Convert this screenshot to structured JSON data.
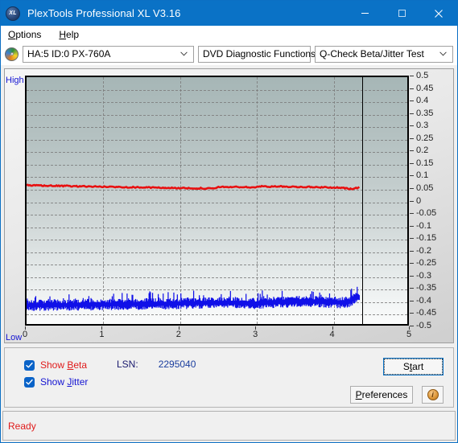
{
  "window": {
    "title": "PlexTools Professional XL V3.16",
    "app_icon": "xl-disc-icon",
    "minimize_label": "—",
    "maximize_label": "□",
    "close_label": "✕"
  },
  "menubar": {
    "items": [
      {
        "label": "Options",
        "accel": "O"
      },
      {
        "label": "Help",
        "accel": "H"
      }
    ]
  },
  "toolbar": {
    "drive_icon": "optical-disc-icon",
    "drive_select": {
      "value": "HA:5 ID:0  PX-760A"
    },
    "function_select": {
      "value": "DVD Diagnostic Functions"
    },
    "test_select": {
      "value": "Q-Check Beta/Jitter Test"
    },
    "chevron": "⌄"
  },
  "chart_data": {
    "type": "line",
    "title": "",
    "xlabel": "",
    "ylabel": "",
    "xlim": [
      0,
      5
    ],
    "ylim": [
      -0.5,
      0.5
    ],
    "grid": true,
    "legend_position": "bottom-left",
    "axis_left_top_label": "High",
    "axis_left_bottom_label": "Low",
    "x_ticks": [
      0,
      1,
      2,
      3,
      4,
      5
    ],
    "x_tick_labels": [
      "0",
      "1",
      "2",
      "3",
      "4",
      "5"
    ],
    "y_ticks": [
      0.5,
      0.45,
      0.4,
      0.35,
      0.3,
      0.25,
      0.2,
      0.15,
      0.1,
      0.05,
      0,
      -0.05,
      -0.1,
      -0.15,
      -0.2,
      -0.25,
      -0.3,
      -0.35,
      -0.4,
      -0.45,
      -0.5
    ],
    "y_tick_labels": [
      "0.5",
      "0.45",
      "0.4",
      "0.35",
      "0.3",
      "0.25",
      "0.2",
      "0.15",
      "0.1",
      "0.05",
      "0",
      "-0.05",
      "-0.1",
      "-0.15",
      "-0.2",
      "-0.25",
      "-0.3",
      "-0.35",
      "-0.4",
      "-0.45",
      "-0.5"
    ],
    "data_end_x": 4.37,
    "series": [
      {
        "name": "Beta",
        "color": "#e81010",
        "x": [
          0.0,
          0.09,
          0.18,
          0.27,
          0.36,
          0.45,
          0.55,
          0.64,
          0.73,
          0.82,
          0.91,
          1.0,
          1.09,
          1.18,
          1.27,
          1.36,
          1.46,
          1.55,
          1.64,
          1.73,
          1.82,
          1.91,
          2.0,
          2.09,
          2.18,
          2.28,
          2.37,
          2.46,
          2.55,
          2.64,
          2.73,
          2.82,
          2.91,
          3.0,
          3.1,
          3.19,
          3.28,
          3.37,
          3.46,
          3.55,
          3.64,
          3.73,
          3.82,
          3.92,
          4.01,
          4.1,
          4.19,
          4.28,
          4.37
        ],
        "y": [
          0.062,
          0.061,
          0.061,
          0.06,
          0.06,
          0.059,
          0.059,
          0.058,
          0.058,
          0.057,
          0.057,
          0.056,
          0.056,
          0.055,
          0.055,
          0.054,
          0.054,
          0.053,
          0.053,
          0.052,
          0.052,
          0.051,
          0.051,
          0.05,
          0.05,
          0.05,
          0.049,
          0.049,
          0.056,
          0.055,
          0.055,
          0.055,
          0.054,
          0.054,
          0.058,
          0.057,
          0.057,
          0.057,
          0.056,
          0.056,
          0.055,
          0.055,
          0.054,
          0.054,
          0.053,
          0.052,
          0.05,
          0.047,
          0.053
        ]
      },
      {
        "name": "Jitter",
        "color": "#1010e8",
        "band_center_x": [
          0.0,
          0.25,
          0.5,
          0.75,
          1.0,
          1.25,
          1.5,
          1.75,
          2.0,
          2.25,
          2.5,
          2.75,
          3.0,
          3.25,
          3.5,
          3.75,
          4.0,
          4.15,
          4.25,
          4.32,
          4.37
        ],
        "band_center_y": [
          -0.424,
          -0.424,
          -0.423,
          -0.422,
          -0.421,
          -0.42,
          -0.419,
          -0.418,
          -0.417,
          -0.415,
          -0.414,
          -0.413,
          -0.417,
          -0.412,
          -0.41,
          -0.409,
          -0.412,
          -0.413,
          -0.408,
          -0.396,
          -0.392
        ],
        "band_halfwidth": 0.018,
        "noise_amplitude": 0.018
      }
    ]
  },
  "controls": {
    "show_beta": {
      "label_pre": "Show ",
      "accel": "B",
      "label_post": "eta",
      "checked": true
    },
    "show_jitter": {
      "label_pre": "Show ",
      "accel": "J",
      "label_post": "itter",
      "checked": true
    },
    "lsn_label": "LSN:",
    "lsn_value": "2295040",
    "start_button": {
      "label_pre": "S",
      "accel": "t",
      "label_post": "art"
    },
    "preferences_button": {
      "accel": "P",
      "label_post": "references"
    },
    "info_button": {
      "glyph": "i",
      "name": "info-icon"
    }
  },
  "statusbar": {
    "text": "Ready"
  }
}
